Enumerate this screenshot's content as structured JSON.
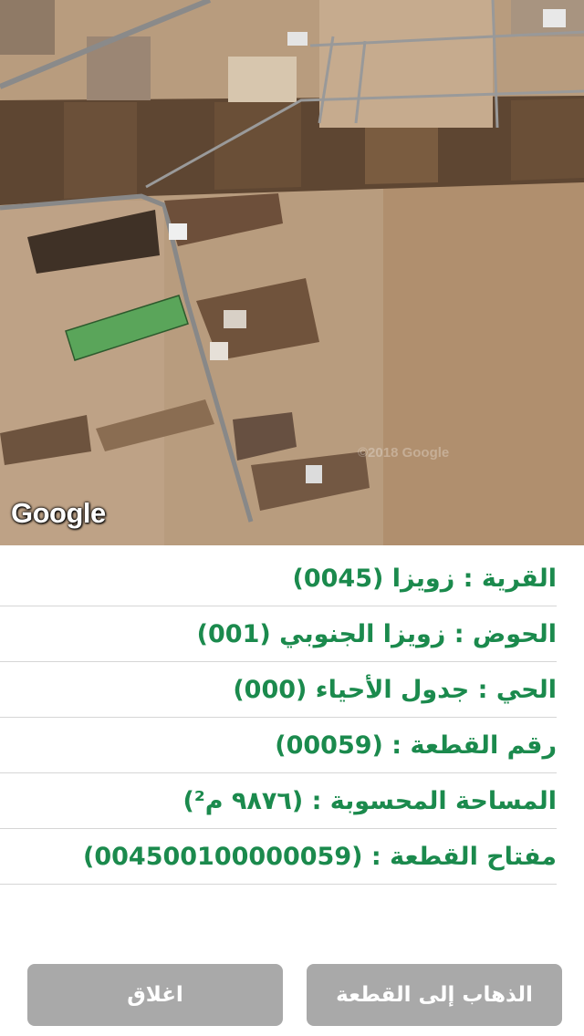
{
  "map": {
    "provider_logo": "Google",
    "watermark": "©2018 Google"
  },
  "parcel_info": [
    {
      "key": "village",
      "text": "القرية : زويزا (0045)"
    },
    {
      "key": "basin",
      "text": "الحوض : زويزا الجنوبي (001)"
    },
    {
      "key": "district",
      "text": "الحي : جدول الأحياء (000)"
    },
    {
      "key": "parcel_number",
      "text": "رقم القطعة : (00059)"
    },
    {
      "key": "area",
      "text": "المساحة المحسوبة : (٩٨٧٦ م²)"
    },
    {
      "key": "parcel_key",
      "text": "مفتاح القطعة : (004500100000059)"
    }
  ],
  "buttons": {
    "close_label": "اغلاق",
    "goto_label": "الذهاب إلى القطعة"
  },
  "colors": {
    "accent_green": "#1b8a4d",
    "button_gray": "#a9a9a9",
    "parcel_fill": "#5aa55a"
  }
}
